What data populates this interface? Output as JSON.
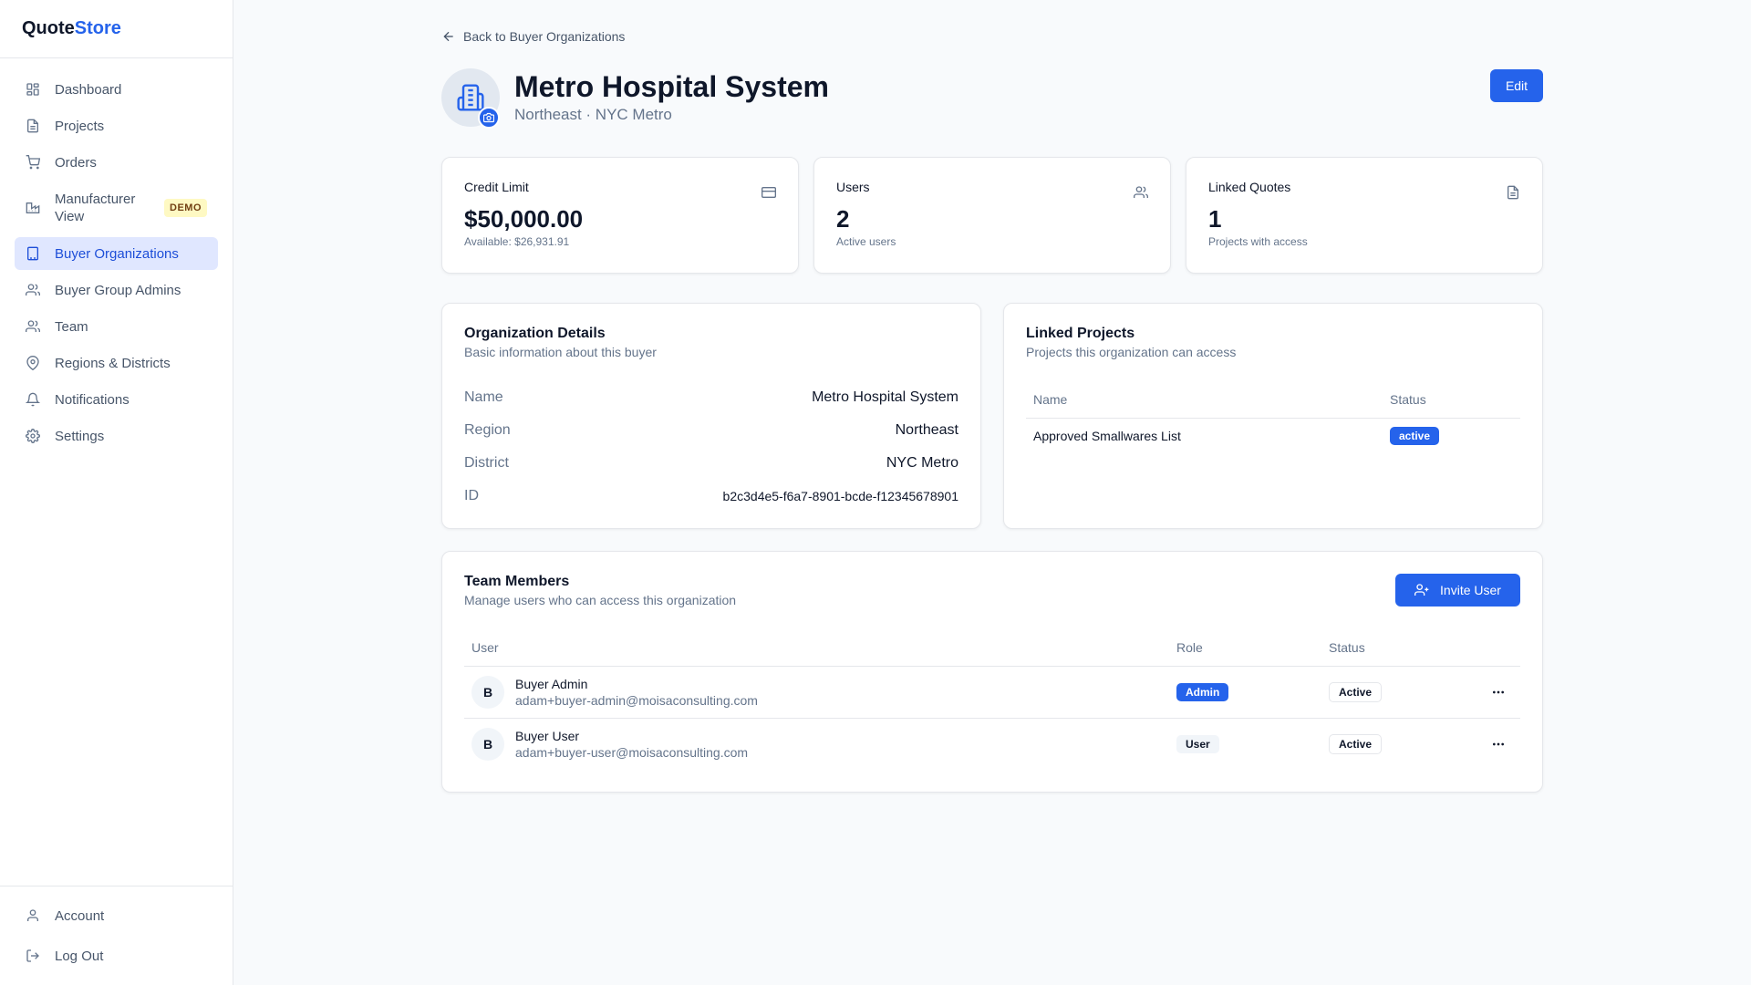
{
  "app": {
    "name_part1": "Quote",
    "name_part2": "Store"
  },
  "sidebar": {
    "items": [
      {
        "label": "Dashboard",
        "icon": "dashboard-icon"
      },
      {
        "label": "Projects",
        "icon": "file-icon"
      },
      {
        "label": "Orders",
        "icon": "cart-icon"
      },
      {
        "label": "Manufacturer View",
        "icon": "factory-icon",
        "badge": "DEMO"
      },
      {
        "label": "Buyer Organizations",
        "icon": "building-icon",
        "active": true
      },
      {
        "label": "Buyer Group Admins",
        "icon": "users-icon"
      },
      {
        "label": "Team",
        "icon": "users-icon"
      },
      {
        "label": "Regions & Districts",
        "icon": "map-pin-icon"
      },
      {
        "label": "Notifications",
        "icon": "bell-icon"
      },
      {
        "label": "Settings",
        "icon": "gear-icon"
      }
    ],
    "bottom": [
      {
        "label": "Account",
        "icon": "user-icon"
      },
      {
        "label": "Log Out",
        "icon": "logout-icon"
      }
    ]
  },
  "breadcrumb": {
    "back_label": "Back to Buyer Organizations"
  },
  "org": {
    "title": "Metro Hospital System",
    "subtitle": "Northeast · NYC Metro",
    "edit_label": "Edit"
  },
  "stats": [
    {
      "label": "Credit Limit",
      "value": "$50,000.00",
      "sub": "Available: $26,931.91",
      "icon": "credit-card-icon"
    },
    {
      "label": "Users",
      "value": "2",
      "sub": "Active users",
      "icon": "users-icon"
    },
    {
      "label": "Linked Quotes",
      "value": "1",
      "sub": "Projects with access",
      "icon": "file-icon"
    }
  ],
  "details": {
    "title": "Organization Details",
    "desc": "Basic information about this buyer",
    "rows": [
      {
        "key": "Name",
        "value": "Metro Hospital System"
      },
      {
        "key": "Region",
        "value": "Northeast"
      },
      {
        "key": "District",
        "value": "NYC Metro"
      },
      {
        "key": "ID",
        "value": "b2c3d4e5-f6a7-8901-bcde-f12345678901"
      }
    ]
  },
  "linked_projects": {
    "title": "Linked Projects",
    "desc": "Projects this organization can access",
    "columns": [
      "Name",
      "Status"
    ],
    "rows": [
      {
        "name": "Approved Smallwares List",
        "status": "active"
      }
    ]
  },
  "team": {
    "title": "Team Members",
    "desc": "Manage users who can access this organization",
    "invite_label": "Invite User",
    "columns": [
      "User",
      "Role",
      "Status",
      ""
    ],
    "rows": [
      {
        "initial": "B",
        "name": "Buyer Admin",
        "email": "adam+buyer-admin@moisaconsulting.com",
        "role": "Admin",
        "status": "Active"
      },
      {
        "initial": "B",
        "name": "Buyer User",
        "email": "adam+buyer-user@moisaconsulting.com",
        "role": "User",
        "status": "Active"
      }
    ]
  },
  "colors": {
    "accent": "#2563eb",
    "active_nav_bg": "#e0e7ff",
    "demo_badge_bg": "#fef9c3"
  }
}
